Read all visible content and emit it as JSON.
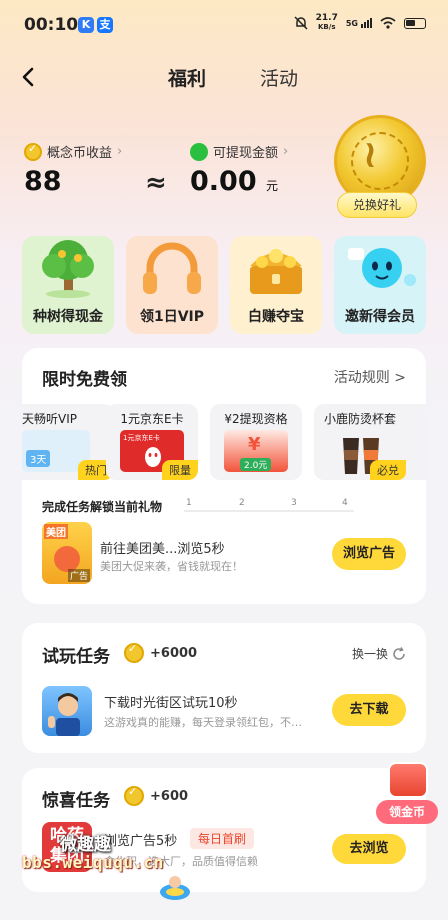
{
  "status_bar": {
    "time": "00:10",
    "app_icons": [
      "K",
      "支"
    ],
    "net_speed_value": "21.7",
    "net_speed_unit": "KB/s",
    "signal": "5G",
    "colors": {
      "k_icon": "#2f7cf6",
      "alipay_icon": "#1677ff"
    }
  },
  "nav": {
    "back_icon": "chevron-left-icon",
    "tabs": [
      {
        "label": "福利",
        "active": true
      },
      {
        "label": "活动",
        "active": false
      }
    ]
  },
  "balance": {
    "coin_label": "概念币收益",
    "coin_value": "88",
    "approx_symbol": "≈",
    "cash_label": "可提现金额",
    "cash_value": "0.00",
    "cash_unit": "元",
    "redeem_button": "兑换好礼"
  },
  "features": [
    {
      "label": "种树得现金",
      "art": "tree-icon",
      "bg": "#dff3d0"
    },
    {
      "label": "领1日VIP",
      "art": "headphones-icon",
      "bg": "#fde3cf"
    },
    {
      "label": "白赚夺宝",
      "art": "treasure-chest-icon",
      "bg": "#fff0cf"
    },
    {
      "label": "邀新得会员",
      "art": "mascot-icon",
      "bg": "#d6f3f7"
    }
  ],
  "limited_free": {
    "title": "限时免费领",
    "rules_link": "活动规则 >",
    "gifts": [
      {
        "name": "天畅听VIP",
        "tag": "热门",
        "badge_text": "3天"
      },
      {
        "name": "1元京东E卡",
        "tag": "限量",
        "badge_text": "1元京东E卡"
      },
      {
        "name": "¥2提现资格",
        "tag": "",
        "badge_text": "2.0元"
      },
      {
        "name": "小鹿防烫杯套",
        "tag": "必兑",
        "badge_text": ""
      }
    ],
    "progress_title": "完成任务解锁当前礼物",
    "progress_steps": [
      "1",
      "2",
      "3",
      "4"
    ],
    "task": {
      "title": "前往美团美...浏览5秒",
      "desc": "美团大促来袭，省钱就现在！",
      "button": "浏览广告",
      "thumb_text": "美团",
      "thumb_sub": "广告"
    }
  },
  "trial_task": {
    "title": "试玩任务",
    "reward": "+6000",
    "refresh": "换一换",
    "task_title": "下载时光街区试玩10秒",
    "task_desc": "这游戏真的能赚，每天登录领红包，不…",
    "button": "去下载"
  },
  "surprise_task": {
    "title": "惊喜任务",
    "reward": "+600",
    "task_title": "浏览广告5秒",
    "daily_tag": "每日首刷",
    "task_desc": "食化积，选大厂，品质值得信赖",
    "button": "去浏览",
    "thumb_text": "哈药集团"
  },
  "float_gift": {
    "label": "领金币"
  },
  "watermark": {
    "cn": "微趣趣",
    "url": "bbs.weiququ.cn"
  }
}
